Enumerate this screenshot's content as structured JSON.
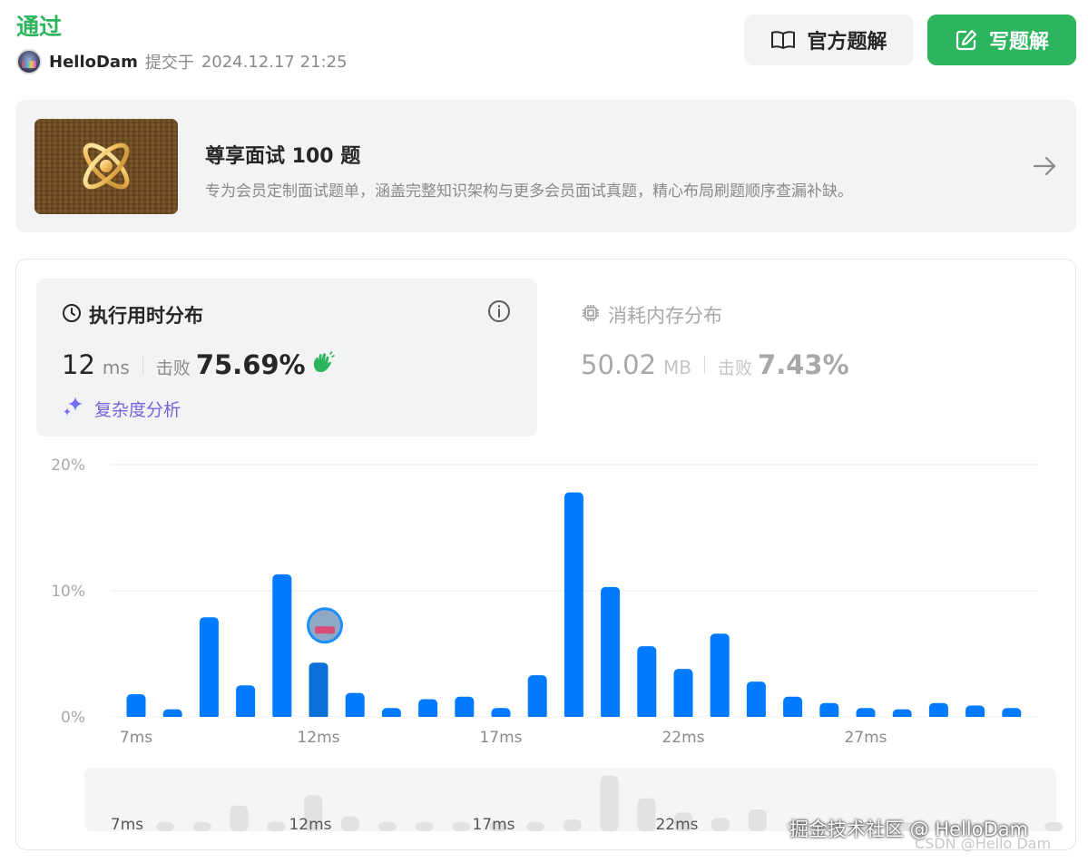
{
  "header": {
    "status": "通过",
    "username": "HelloDam",
    "submit_text": "提交于",
    "submit_time": "2024.12.17 21:25",
    "official_solution_label": "官方题解",
    "write_solution_label": "写题解"
  },
  "promo": {
    "title": "尊享面试 100 题",
    "description": "专为会员定制面试题单，涵盖完整知识架构与更多会员面试真题，精心布局刷题顺序查漏补缺。"
  },
  "runtime": {
    "title": "执行用时分布",
    "value": "12",
    "unit": "ms",
    "beat_label": "击败",
    "beat_pct": "75.69%",
    "complexity_label": "复杂度分析"
  },
  "memory": {
    "title": "消耗内存分布",
    "value": "50.02",
    "unit": "MB",
    "beat_label": "击败",
    "beat_pct": "7.43%"
  },
  "colors": {
    "accent_green": "#2db55d",
    "bar_blue": "#007aff",
    "bar_highlight": "#0a6fd6",
    "preview_bar": "#e2e2e2"
  },
  "chart_data": {
    "type": "bar",
    "categories": [
      "7ms",
      "8ms",
      "9ms",
      "10ms",
      "11ms",
      "12ms",
      "13ms",
      "14ms",
      "15ms",
      "16ms",
      "17ms",
      "18ms",
      "19ms",
      "20ms",
      "21ms",
      "22ms",
      "23ms",
      "24ms",
      "25ms",
      "26ms",
      "27ms",
      "28ms",
      "29ms",
      "30ms",
      "31ms"
    ],
    "values": [
      1.8,
      0.6,
      7.9,
      2.5,
      11.3,
      4.3,
      1.9,
      0.7,
      1.4,
      1.6,
      0.7,
      3.3,
      17.8,
      10.3,
      5.6,
      3.8,
      6.6,
      2.8,
      1.6,
      1.1,
      0.7,
      0.6,
      1.1,
      0.9,
      0.7
    ],
    "highlight_index": 5,
    "x_tick_labels": [
      "7ms",
      "12ms",
      "17ms",
      "22ms",
      "27ms"
    ],
    "y_tick_labels": [
      "0%",
      "10%",
      "20%"
    ],
    "ylim": [
      0,
      20
    ],
    "grid": true
  }
}
